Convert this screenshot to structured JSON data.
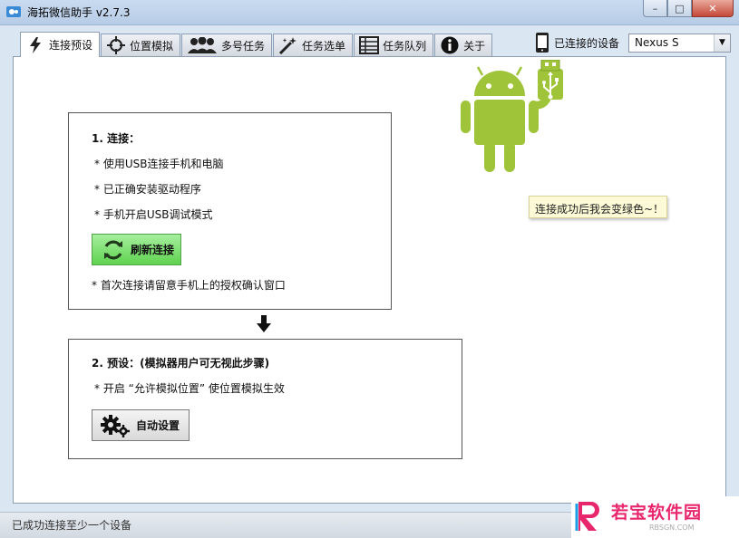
{
  "window": {
    "title": "海拓微信助手 v2.7.3",
    "minimize_glyph": "–",
    "maximize_glyph": "□",
    "close_glyph": "✕"
  },
  "tabs": [
    {
      "label": "连接预设",
      "icon": "lightning-icon",
      "active": true
    },
    {
      "label": "位置模拟",
      "icon": "crosshair-icon",
      "active": false
    },
    {
      "label": "多号任务",
      "icon": "users-icon",
      "active": false
    },
    {
      "label": "任务选单",
      "icon": "magic-wand-icon",
      "active": false
    },
    {
      "label": "任务队列",
      "icon": "grid-icon",
      "active": false
    },
    {
      "label": "关于",
      "icon": "info-icon",
      "active": false
    }
  ],
  "device": {
    "label": "已连接的设备",
    "selected": "Nexus S"
  },
  "step1": {
    "title": "1. 连接：",
    "items": [
      "* 使用USB连接手机和电脑",
      "* 已正确安装驱动程序",
      "* 手机开启USB调试模式"
    ],
    "button_label": "刷新连接",
    "note": "* 首次连接请留意手机上的授权确认窗口"
  },
  "step2": {
    "title": "2. 预设：(模拟器用户可无视此步骤)",
    "item": "* 开启 “允许模拟位置” 使位置模拟生效",
    "button_label": "自动设置"
  },
  "tooltip": "连接成功后我会变绿色~！",
  "status": "已成功连接至少一个设备",
  "watermark": {
    "text": "若宝软件园",
    "sub": "RBSGN.COM"
  },
  "colors": {
    "android_green": "#9fc43a",
    "refresh_button": "#6bd45c",
    "watermark_pink": "#e8266c"
  }
}
